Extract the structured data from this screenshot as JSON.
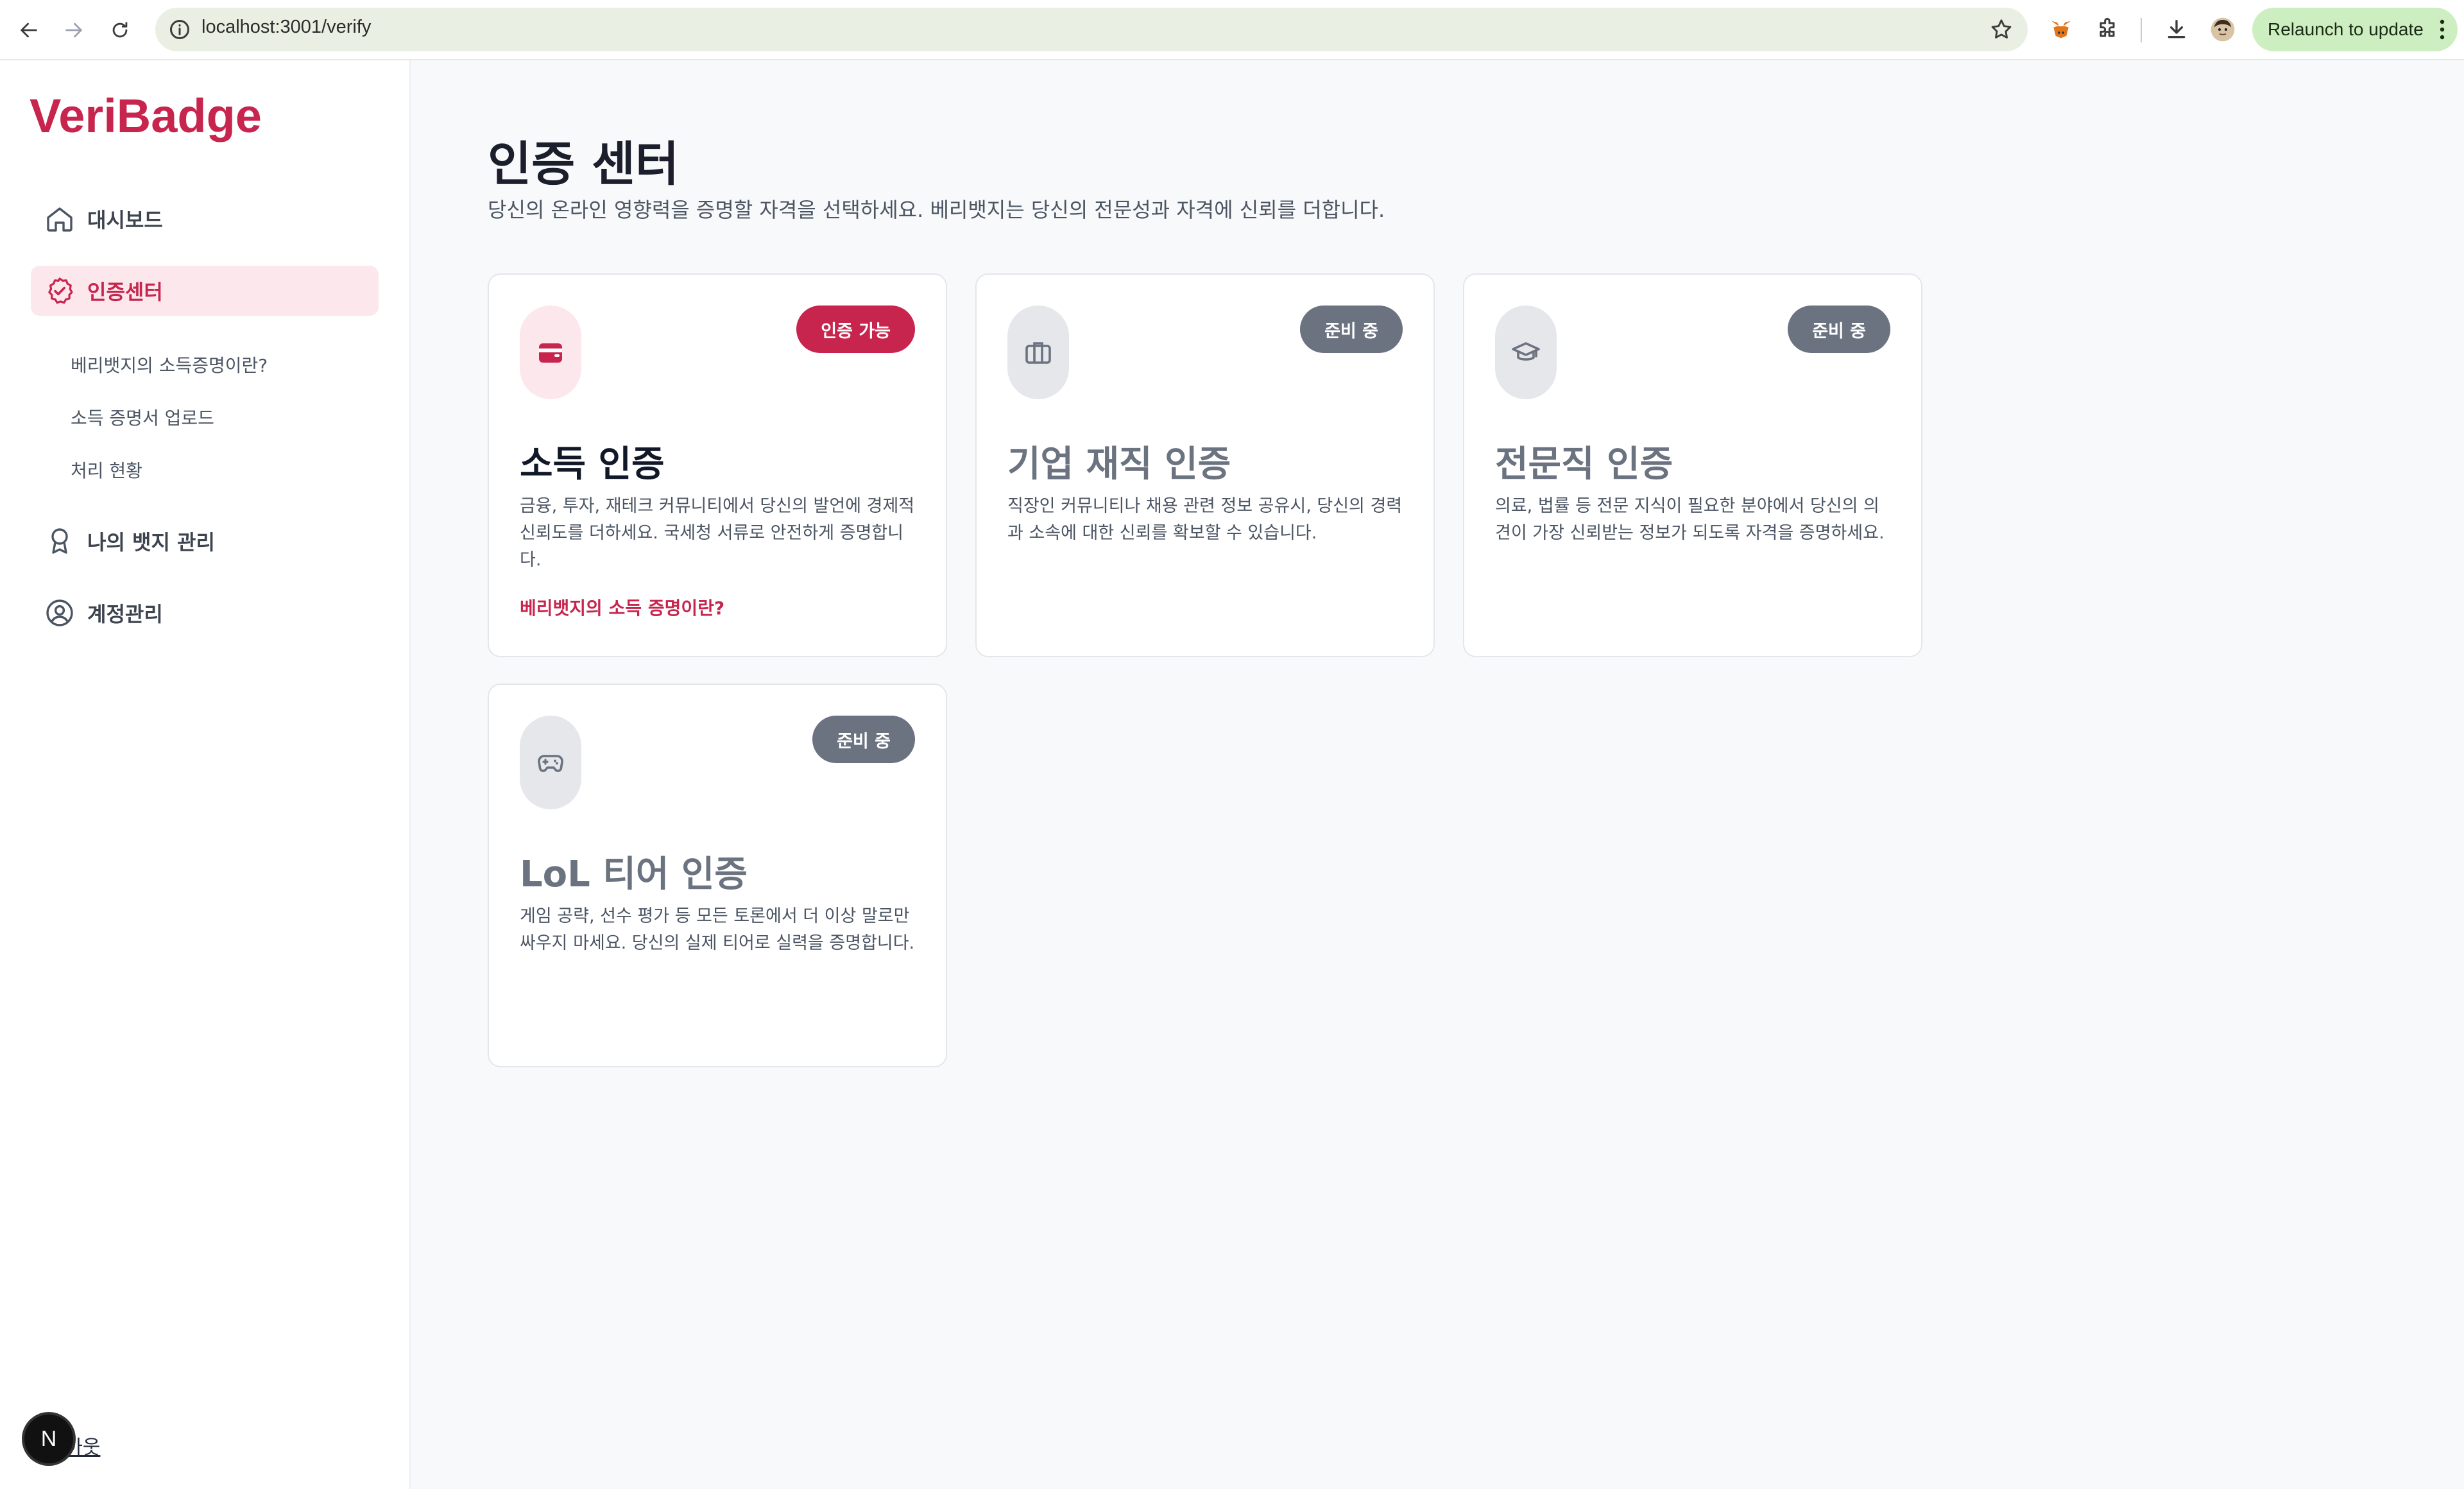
{
  "browser": {
    "url": "localhost:3001/verify",
    "relaunch_label": "Relaunch to update"
  },
  "app": {
    "logo": "VeriBadge"
  },
  "sidebar": {
    "items": [
      {
        "label": "대시보드",
        "icon": "home-icon"
      },
      {
        "label": "인증센터",
        "icon": "check-badge-icon"
      },
      {
        "label": "나의 뱃지 관리",
        "icon": "ribbon-icon"
      },
      {
        "label": "계정관리",
        "icon": "user-circle-icon"
      }
    ],
    "sub_items": [
      {
        "label": "베리뱃지의 소득증명이란?"
      },
      {
        "label": "소득 증명서 업로드"
      },
      {
        "label": "처리 현황"
      }
    ],
    "logout_label": "로그아웃",
    "dev_badge": "N"
  },
  "colors": {
    "accent": "#c7254e",
    "accent_soft": "#fce7ec",
    "neutral_badge": "#6b7280"
  },
  "main": {
    "title": "인증 센터",
    "subtitle": "당신의 온라인 영향력을 증명할 자격을 선택하세요. 베리뱃지는 당신의 전문성과 자격에 신뢰를 더합니다.",
    "cards": [
      {
        "title": "소득 인증",
        "status": "인증 가능",
        "icon": "wallet-icon",
        "description": "금융, 투자, 재테크 커뮤니티에서 당신의 발언에 경제적 신뢰도를 더하세요. 국세청 서류로 안전하게 증명합니다.",
        "link": "베리뱃지의 소득 증명이란?"
      },
      {
        "title": "기업 재직 인증",
        "status": "준비 중",
        "icon": "briefcase-icon",
        "description": "직장인 커뮤니티나 채용 관련 정보 공유시, 당신의 경력과 소속에 대한 신뢰를 확보할 수 있습니다."
      },
      {
        "title": "전문직 인증",
        "status": "준비 중",
        "icon": "graduation-cap-icon",
        "description": "의료, 법률 등 전문 지식이 필요한 분야에서 당신의 의견이 가장 신뢰받는 정보가 되도록 자격을 증명하세요."
      },
      {
        "title": "LoL 티어 인증",
        "status": "준비 중",
        "icon": "gamepad-icon",
        "description": "게임 공략, 선수 평가 등 모든 토론에서 더 이상 말로만 싸우지 마세요. 당신의 실제 티어로 실력을 증명합니다."
      }
    ]
  }
}
